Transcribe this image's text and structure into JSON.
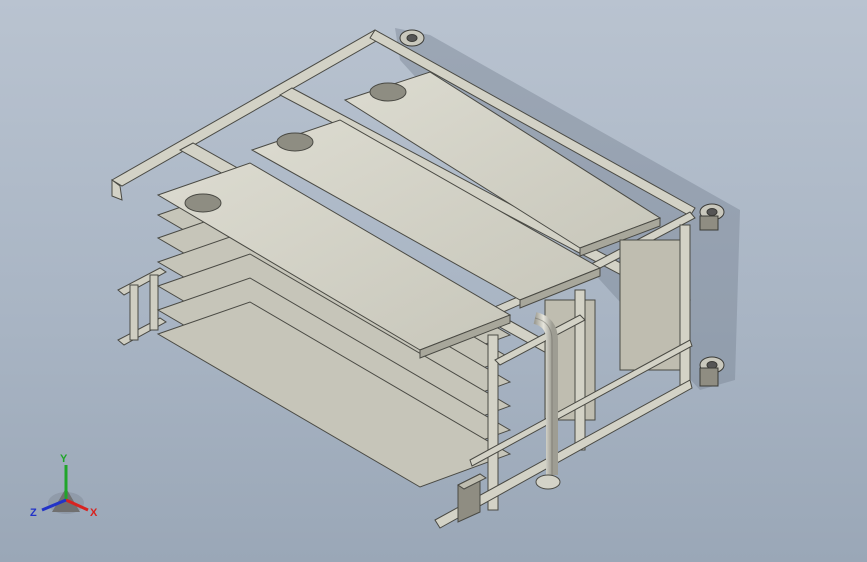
{
  "viewport": {
    "model": "rack-frame-assembly",
    "background_top": "#b9c3d0",
    "background_bottom": "#9aa7b7"
  },
  "colors": {
    "metal_light": "#d6d5c9",
    "metal_mid": "#bfbdb0",
    "metal_dark": "#8f8d82",
    "edge": "#4a4a44",
    "pipe": "#c9c8bd",
    "shadow": "#6d7888"
  },
  "triad": {
    "x_label": "X",
    "y_label": "Y",
    "z_label": "Z",
    "x_color": "#d8231f",
    "y_color": "#20a52a",
    "z_color": "#2233c8"
  }
}
